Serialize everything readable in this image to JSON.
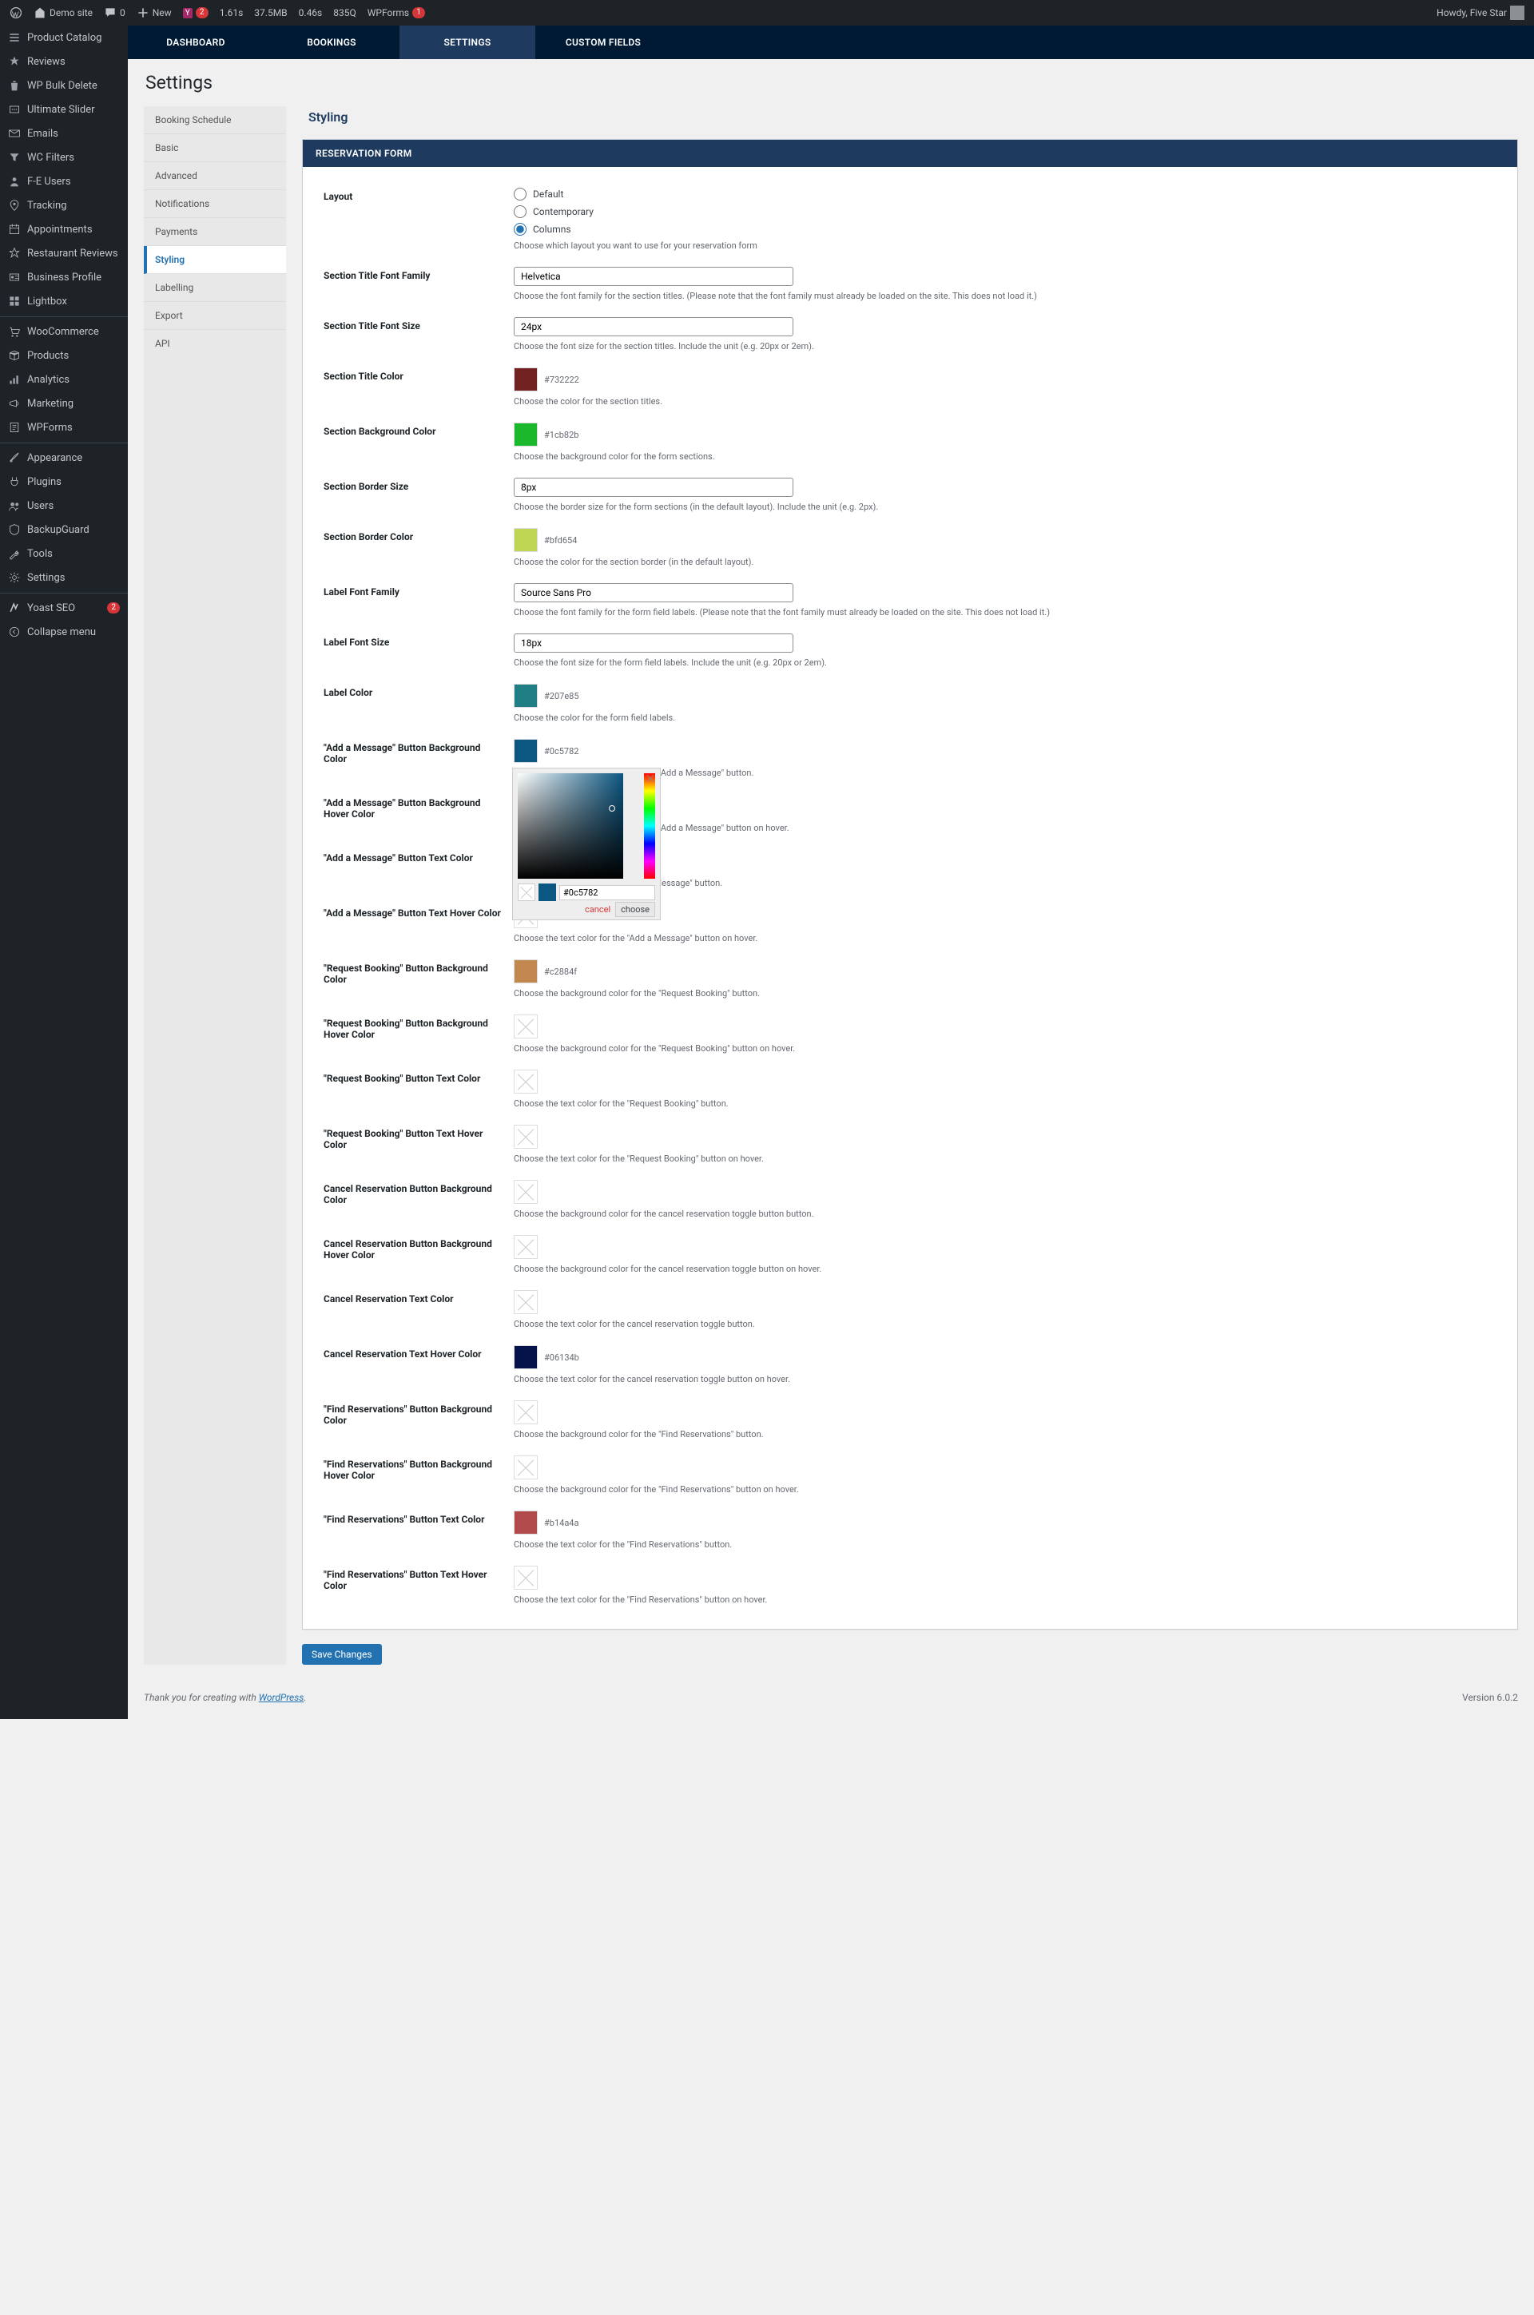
{
  "adminbar": {
    "site": "Demo site",
    "comments": "0",
    "new": "New",
    "yoast_count": "2",
    "perf": {
      "time": "1.61s",
      "mem": "37.5MB",
      "load": "0.46s",
      "q": "835Q"
    },
    "wpforms": "WPForms",
    "wpforms_count": "1",
    "howdy": "Howdy, Five Star"
  },
  "sidemenu": [
    {
      "label": "Product Catalog",
      "icon": "list"
    },
    {
      "label": "Reviews",
      "icon": "star"
    },
    {
      "label": "WP Bulk Delete",
      "icon": "trash"
    },
    {
      "label": "Ultimate Slider",
      "icon": "slides"
    },
    {
      "label": "Emails",
      "icon": "email"
    },
    {
      "label": "WC Filters",
      "icon": "filter"
    },
    {
      "label": "F-E Users",
      "icon": "user"
    },
    {
      "label": "Tracking",
      "icon": "location"
    },
    {
      "label": "Appointments",
      "icon": "calendar"
    },
    {
      "label": "Restaurant Reviews",
      "icon": "star-empty"
    },
    {
      "label": "Business Profile",
      "icon": "id"
    },
    {
      "label": "Lightbox",
      "icon": "grid"
    },
    {
      "label": "WooCommerce",
      "icon": "cart",
      "sep": true
    },
    {
      "label": "Products",
      "icon": "box"
    },
    {
      "label": "Analytics",
      "icon": "chart"
    },
    {
      "label": "Marketing",
      "icon": "megaphone"
    },
    {
      "label": "WPForms",
      "icon": "form"
    },
    {
      "label": "Appearance",
      "icon": "brush",
      "sep": true
    },
    {
      "label": "Plugins",
      "icon": "plug"
    },
    {
      "label": "Users",
      "icon": "users"
    },
    {
      "label": "BackupGuard",
      "icon": "shield"
    },
    {
      "label": "Tools",
      "icon": "wrench"
    },
    {
      "label": "Settings",
      "icon": "gear"
    },
    {
      "label": "Yoast SEO",
      "icon": "yoast",
      "sep": true,
      "badge": "2"
    },
    {
      "label": "Collapse menu",
      "icon": "collapse"
    }
  ],
  "navtabs": [
    "DASHBOARD",
    "BOOKINGS",
    "SETTINGS",
    "CUSTOM FIELDS"
  ],
  "page_title": "Settings",
  "submenu": [
    "Booking Schedule",
    "Basic",
    "Advanced",
    "Notifications",
    "Payments",
    "Styling",
    "Labelling",
    "Export",
    "API"
  ],
  "submenu_active": 5,
  "panel_heading": "Styling",
  "form": {
    "title": "RESERVATION FORM",
    "layout": {
      "label": "Layout",
      "options": [
        "Default",
        "Contemporary",
        "Columns"
      ],
      "value": "Columns",
      "desc": "Choose which layout you want to use for your reservation form"
    },
    "sectionTitleFontFamily": {
      "label": "Section Title Font Family",
      "value": "Helvetica",
      "desc": "Choose the font family for the section titles. (Please note that the font family must already be loaded on the site. This does not load it.)"
    },
    "sectionTitleFontSize": {
      "label": "Section Title Font Size",
      "value": "24px",
      "desc": "Choose the font size for the section titles. Include the unit (e.g. 20px or 2em)."
    },
    "sectionTitleColor": {
      "label": "Section Title Color",
      "value": "#732222",
      "desc": "Choose the color for the section titles."
    },
    "sectionBgColor": {
      "label": "Section Background Color",
      "value": "#1cb82b",
      "desc": "Choose the background color for the form sections."
    },
    "sectionBorderSize": {
      "label": "Section Border Size",
      "value": "8px",
      "desc": "Choose the border size for the form sections (in the default layout). Include the unit (e.g. 2px)."
    },
    "sectionBorderColor": {
      "label": "Section Border Color",
      "value": "#bfd654",
      "desc": "Choose the color for the section border (in the default layout)."
    },
    "labelFontFamily": {
      "label": "Label Font Family",
      "value": "Source Sans Pro",
      "desc": "Choose the font family for the form field labels. (Please note that the font family must already be loaded on the site. This does not load it.)"
    },
    "labelFontSize": {
      "label": "Label Font Size",
      "value": "18px",
      "desc": "Choose the font size for the form field labels. Include the unit (e.g. 20px or 2em)."
    },
    "labelColor": {
      "label": "Label Color",
      "value": "#207e85",
      "desc": "Choose the color for the form field labels."
    },
    "addMsgBg": {
      "label": "\"Add a Message\" Button Background Color",
      "value": "#0c5782",
      "desc": "Choose the background color for the \"Add a Message\" button."
    },
    "addMsgBgHover": {
      "label": "\"Add a Message\" Button Background Hover Color",
      "value": "",
      "desc": "Choose the background color for the \"Add a Message\" button on hover."
    },
    "addMsgText": {
      "label": "\"Add a Message\" Button Text Color",
      "value": "",
      "desc": "Choose the text color for the \"Add a Message\" button."
    },
    "addMsgTextHover": {
      "label": "\"Add a Message\" Button Text Hover Color",
      "value": "",
      "desc": "Choose the text color for the \"Add a Message\" button on hover."
    },
    "reqBg": {
      "label": "\"Request Booking\" Button Background Color",
      "value": "#c2884f",
      "desc": "Choose the background color for the \"Request Booking\" button."
    },
    "reqBgHover": {
      "label": "\"Request Booking\" Button Background Hover Color",
      "value": "",
      "desc": "Choose the background color for the \"Request Booking\" button on hover."
    },
    "reqText": {
      "label": "\"Request Booking\" Button Text Color",
      "value": "",
      "desc": "Choose the text color for the \"Request Booking\" button."
    },
    "reqTextHover": {
      "label": "\"Request Booking\" Button Text Hover Color",
      "value": "",
      "desc": "Choose the text color for the \"Request Booking\" button on hover."
    },
    "cancelBg": {
      "label": "Cancel Reservation Button Background Color",
      "value": "",
      "desc": "Choose the background color for the cancel reservation toggle button button."
    },
    "cancelBgHover": {
      "label": "Cancel Reservation Button Background Hover Color",
      "value": "",
      "desc": "Choose the background color for the cancel reservation toggle button on hover."
    },
    "cancelText": {
      "label": "Cancel Reservation Text Color",
      "value": "",
      "desc": "Choose the text color for the cancel reservation toggle button."
    },
    "cancelTextHover": {
      "label": "Cancel Reservation Text Hover Color",
      "value": "#06134b",
      "desc": "Choose the text color for the cancel reservation toggle button on hover."
    },
    "findBg": {
      "label": "\"Find Reservations\" Button Background Color",
      "value": "",
      "desc": "Choose the background color for the \"Find Reservations\" button."
    },
    "findBgHover": {
      "label": "\"Find Reservations\" Button Background Hover Color",
      "value": "",
      "desc": "Choose the background color for the \"Find Reservations\" button on hover."
    },
    "findText": {
      "label": "\"Find Reservations\" Button Text Color",
      "value": "#b14a4a",
      "desc": "Choose the text color for the \"Find Reservations\" button."
    },
    "findTextHover": {
      "label": "\"Find Reservations\" Button Text Hover Color",
      "value": "",
      "desc": "Choose the text color for the \"Find Reservations\" button on hover."
    }
  },
  "picker": {
    "value": "#0c5782",
    "cancel": "cancel",
    "choose": "choose"
  },
  "save": "Save Changes",
  "footer": {
    "thank": "Thank you for creating with ",
    "wp": "WordPress",
    "dot": ".",
    "ver": "Version 6.0.2"
  }
}
